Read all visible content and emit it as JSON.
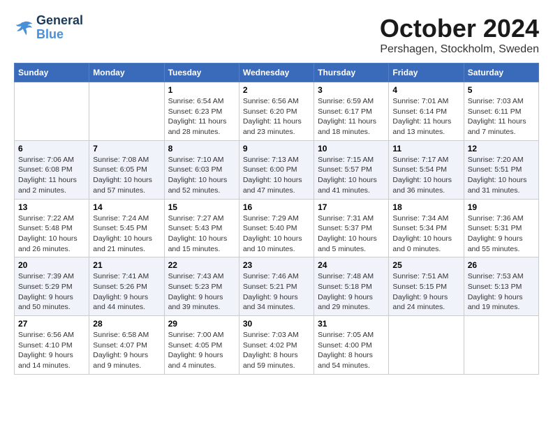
{
  "header": {
    "logo": {
      "line1": "General",
      "line2": "Blue"
    },
    "month": "October 2024",
    "location": "Pershagen, Stockholm, Sweden"
  },
  "days_of_week": [
    "Sunday",
    "Monday",
    "Tuesday",
    "Wednesday",
    "Thursday",
    "Friday",
    "Saturday"
  ],
  "weeks": [
    [
      {
        "day": "",
        "info": ""
      },
      {
        "day": "",
        "info": ""
      },
      {
        "day": "1",
        "sunrise": "6:54 AM",
        "sunset": "6:23 PM",
        "daylight": "11 hours and 28 minutes."
      },
      {
        "day": "2",
        "sunrise": "6:56 AM",
        "sunset": "6:20 PM",
        "daylight": "11 hours and 23 minutes."
      },
      {
        "day": "3",
        "sunrise": "6:59 AM",
        "sunset": "6:17 PM",
        "daylight": "11 hours and 18 minutes."
      },
      {
        "day": "4",
        "sunrise": "7:01 AM",
        "sunset": "6:14 PM",
        "daylight": "11 hours and 13 minutes."
      },
      {
        "day": "5",
        "sunrise": "7:03 AM",
        "sunset": "6:11 PM",
        "daylight": "11 hours and 7 minutes."
      }
    ],
    [
      {
        "day": "6",
        "sunrise": "7:06 AM",
        "sunset": "6:08 PM",
        "daylight": "11 hours and 2 minutes."
      },
      {
        "day": "7",
        "sunrise": "7:08 AM",
        "sunset": "6:05 PM",
        "daylight": "10 hours and 57 minutes."
      },
      {
        "day": "8",
        "sunrise": "7:10 AM",
        "sunset": "6:03 PM",
        "daylight": "10 hours and 52 minutes."
      },
      {
        "day": "9",
        "sunrise": "7:13 AM",
        "sunset": "6:00 PM",
        "daylight": "10 hours and 47 minutes."
      },
      {
        "day": "10",
        "sunrise": "7:15 AM",
        "sunset": "5:57 PM",
        "daylight": "10 hours and 41 minutes."
      },
      {
        "day": "11",
        "sunrise": "7:17 AM",
        "sunset": "5:54 PM",
        "daylight": "10 hours and 36 minutes."
      },
      {
        "day": "12",
        "sunrise": "7:20 AM",
        "sunset": "5:51 PM",
        "daylight": "10 hours and 31 minutes."
      }
    ],
    [
      {
        "day": "13",
        "sunrise": "7:22 AM",
        "sunset": "5:48 PM",
        "daylight": "10 hours and 26 minutes."
      },
      {
        "day": "14",
        "sunrise": "7:24 AM",
        "sunset": "5:45 PM",
        "daylight": "10 hours and 21 minutes."
      },
      {
        "day": "15",
        "sunrise": "7:27 AM",
        "sunset": "5:43 PM",
        "daylight": "10 hours and 15 minutes."
      },
      {
        "day": "16",
        "sunrise": "7:29 AM",
        "sunset": "5:40 PM",
        "daylight": "10 hours and 10 minutes."
      },
      {
        "day": "17",
        "sunrise": "7:31 AM",
        "sunset": "5:37 PM",
        "daylight": "10 hours and 5 minutes."
      },
      {
        "day": "18",
        "sunrise": "7:34 AM",
        "sunset": "5:34 PM",
        "daylight": "10 hours and 0 minutes."
      },
      {
        "day": "19",
        "sunrise": "7:36 AM",
        "sunset": "5:31 PM",
        "daylight": "9 hours and 55 minutes."
      }
    ],
    [
      {
        "day": "20",
        "sunrise": "7:39 AM",
        "sunset": "5:29 PM",
        "daylight": "9 hours and 50 minutes."
      },
      {
        "day": "21",
        "sunrise": "7:41 AM",
        "sunset": "5:26 PM",
        "daylight": "9 hours and 44 minutes."
      },
      {
        "day": "22",
        "sunrise": "7:43 AM",
        "sunset": "5:23 PM",
        "daylight": "9 hours and 39 minutes."
      },
      {
        "day": "23",
        "sunrise": "7:46 AM",
        "sunset": "5:21 PM",
        "daylight": "9 hours and 34 minutes."
      },
      {
        "day": "24",
        "sunrise": "7:48 AM",
        "sunset": "5:18 PM",
        "daylight": "9 hours and 29 minutes."
      },
      {
        "day": "25",
        "sunrise": "7:51 AM",
        "sunset": "5:15 PM",
        "daylight": "9 hours and 24 minutes."
      },
      {
        "day": "26",
        "sunrise": "7:53 AM",
        "sunset": "5:13 PM",
        "daylight": "9 hours and 19 minutes."
      }
    ],
    [
      {
        "day": "27",
        "sunrise": "6:56 AM",
        "sunset": "4:10 PM",
        "daylight": "9 hours and 14 minutes."
      },
      {
        "day": "28",
        "sunrise": "6:58 AM",
        "sunset": "4:07 PM",
        "daylight": "9 hours and 9 minutes."
      },
      {
        "day": "29",
        "sunrise": "7:00 AM",
        "sunset": "4:05 PM",
        "daylight": "9 hours and 4 minutes."
      },
      {
        "day": "30",
        "sunrise": "7:03 AM",
        "sunset": "4:02 PM",
        "daylight": "8 hours and 59 minutes."
      },
      {
        "day": "31",
        "sunrise": "7:05 AM",
        "sunset": "4:00 PM",
        "daylight": "8 hours and 54 minutes."
      },
      {
        "day": "",
        "info": ""
      },
      {
        "day": "",
        "info": ""
      }
    ]
  ],
  "labels": {
    "sunrise": "Sunrise:",
    "sunset": "Sunset:",
    "daylight": "Daylight hours"
  }
}
